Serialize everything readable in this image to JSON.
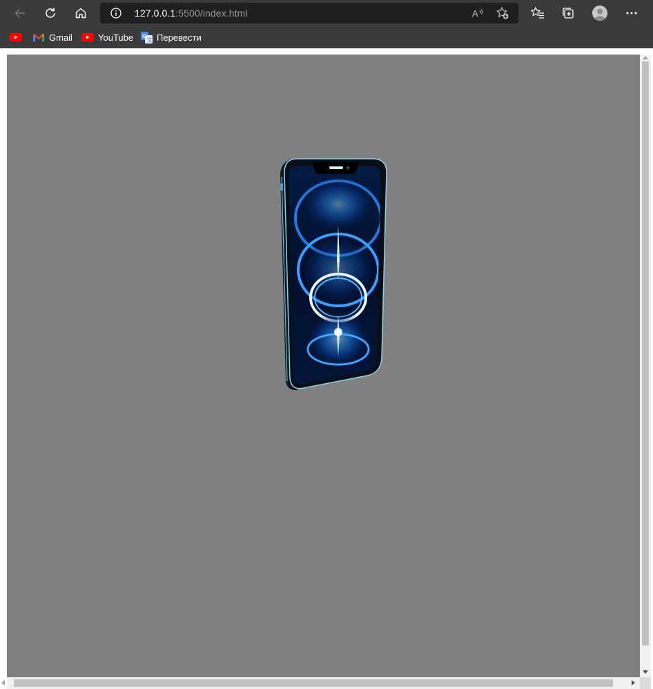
{
  "browser": {
    "url_host": "127.0.0.1",
    "url_rest": ":5500/index.html",
    "toolbar_icons": [
      "back-icon",
      "refresh-icon",
      "home-icon",
      "info-icon",
      "read-aloud-icon",
      "add-favorite-icon",
      "favorites-icon",
      "collections-icon",
      "profile-icon",
      "more-icon"
    ],
    "bookmarks": [
      {
        "label": "",
        "icon": "youtube-icon"
      },
      {
        "label": "Gmail",
        "icon": "gmail-icon"
      },
      {
        "label": "YouTube",
        "icon": "youtube-icon"
      },
      {
        "label": "Перевести",
        "icon": "translate-icon"
      }
    ]
  },
  "page": {
    "background_color": "#808080",
    "scene_object": "smartphone-model-3d"
  },
  "colors": {
    "chrome": "#3b3b3b",
    "address_bg": "#1f1f1f",
    "scrollbar_track": "#f1f1f1",
    "scrollbar_thumb": "#c1c1c1"
  }
}
